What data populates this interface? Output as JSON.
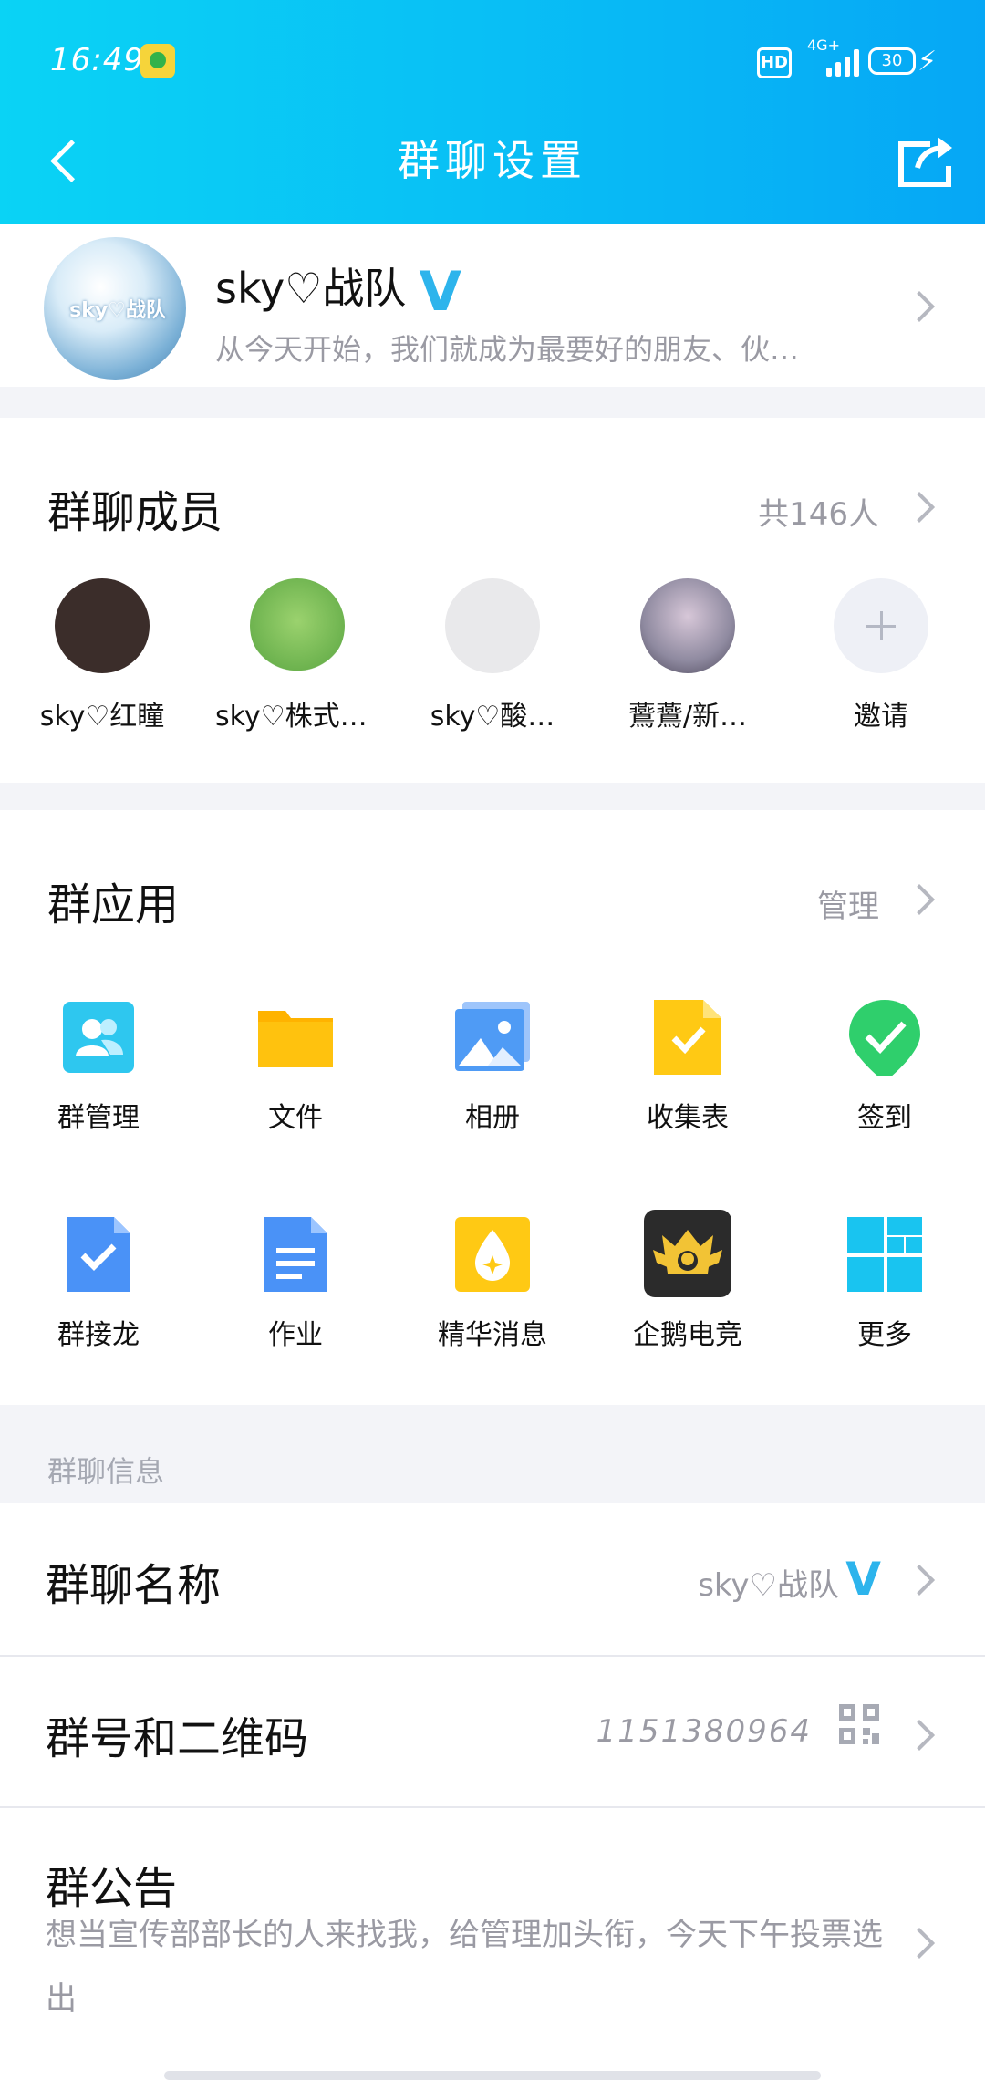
{
  "status": {
    "time": "16:49",
    "hd": "HD",
    "network": "4G+",
    "battery": "30"
  },
  "nav": {
    "title": "群聊设置"
  },
  "group": {
    "name": "sky♡战队",
    "desc": "从今天开始，我们就成为最要好的朋友、伙…",
    "avatar_text": "sky♡战队"
  },
  "members": {
    "title": "群聊成员",
    "count": "共146人",
    "list": [
      {
        "name": "sky♡红瞳",
        "color": "#3b2d2a"
      },
      {
        "name": "sky♡株式会社…",
        "color": "#7dc36a"
      },
      {
        "name": "sky♡酸…",
        "color": "#e9e9eb"
      },
      {
        "name": "鷰鷰/新…",
        "color": "#8f8aa0"
      }
    ],
    "invite": "邀请"
  },
  "apps": {
    "title": "群应用",
    "manage": "管理",
    "items": [
      {
        "label": "群管理",
        "icon": "group-manage-icon",
        "color": "#2ec7ef"
      },
      {
        "label": "文件",
        "icon": "folder-icon",
        "color": "#ffc20e"
      },
      {
        "label": "相册",
        "icon": "album-icon",
        "color": "#4f9bf5"
      },
      {
        "label": "收集表",
        "icon": "form-icon",
        "color": "#ffc914"
      },
      {
        "label": "签到",
        "icon": "checkin-icon",
        "color": "#2fcf6c"
      },
      {
        "label": "群接龙",
        "icon": "relay-icon",
        "color": "#4a92f7"
      },
      {
        "label": "作业",
        "icon": "homework-icon",
        "color": "#4a92f7"
      },
      {
        "label": "精华消息",
        "icon": "essence-icon",
        "color": "#ffc914"
      },
      {
        "label": "企鹅电竞",
        "icon": "esports-icon",
        "color": "#2b2b2b"
      },
      {
        "label": "更多",
        "icon": "more-icon",
        "color": "#19c4f0"
      }
    ]
  },
  "info": {
    "section_label": "群聊信息",
    "name_title": "群聊名称",
    "name_value": "sky♡战队",
    "number_title": "群号和二维码",
    "number_value": "1151380964",
    "notice_title": "群公告",
    "notice_text": "想当宣传部部长的人来找我，给管理加头衔，今天下午投票选出"
  }
}
